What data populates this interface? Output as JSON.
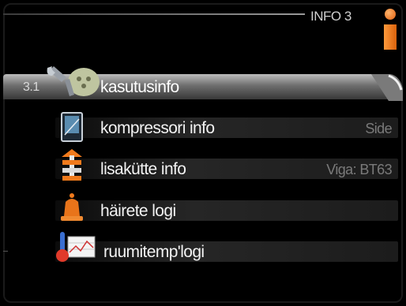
{
  "header": {
    "title": "INFO 3"
  },
  "menu": {
    "selected": {
      "number": "3.1",
      "label": "kasutusinfo"
    },
    "items": [
      {
        "label": "kompressori info",
        "value": "Side"
      },
      {
        "label": "lisakütte info",
        "value": "Viga: BT63"
      },
      {
        "label": "häirete logi",
        "value": ""
      },
      {
        "label": "ruumitemp'logi",
        "value": ""
      }
    ]
  },
  "colors": {
    "accent": "#f07a1c",
    "text": "#f2f2f2",
    "value_text": "#7a7a7a",
    "background": "#000000"
  }
}
